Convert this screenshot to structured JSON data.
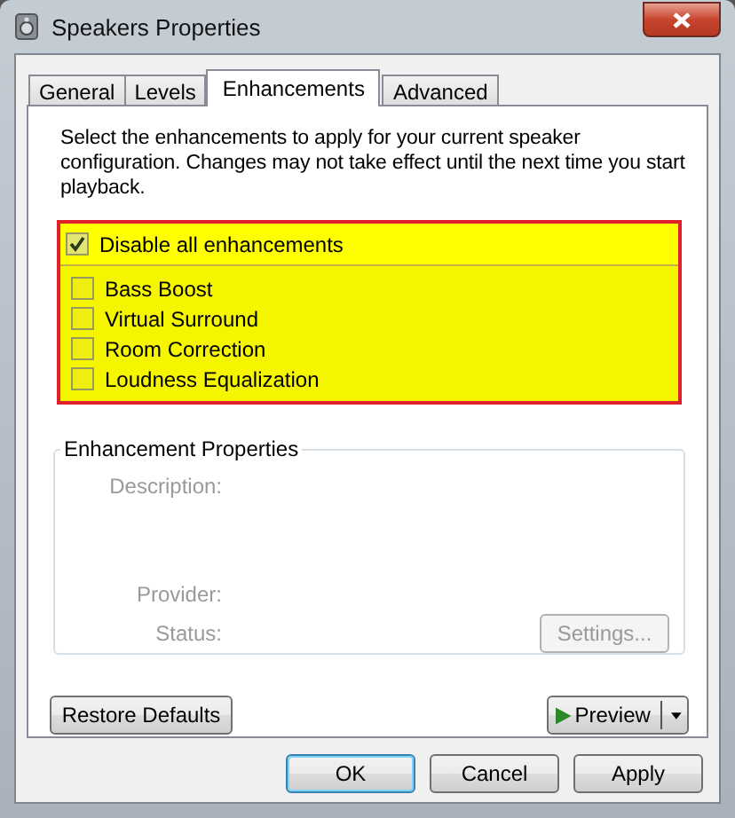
{
  "window": {
    "title": "Speakers Properties"
  },
  "tabs": [
    {
      "label": "General",
      "selected": false
    },
    {
      "label": "Levels",
      "selected": false
    },
    {
      "label": "Enhancements",
      "selected": true
    },
    {
      "label": "Advanced",
      "selected": false
    }
  ],
  "intro": "Select the enhancements to apply for your current speaker configuration. Changes may not take effect until the next time you start playback.",
  "master_option": {
    "label": "Disable all enhancements",
    "checked": true
  },
  "enhancements": [
    {
      "label": "Bass Boost",
      "checked": false
    },
    {
      "label": "Virtual Surround",
      "checked": false
    },
    {
      "label": "Room Correction",
      "checked": false
    },
    {
      "label": "Loudness Equalization",
      "checked": false
    }
  ],
  "properties": {
    "title": "Enhancement Properties",
    "disabled": true,
    "description_label": "Description:",
    "provider_label": "Provider:",
    "status_label": "Status:",
    "settings_button": {
      "label": "Settings...",
      "disabled": true
    }
  },
  "restore_button": "Restore Defaults",
  "preview_button": "Preview",
  "buttons": [
    {
      "label": "OK",
      "selected": true
    },
    {
      "label": "Cancel",
      "selected": false
    },
    {
      "label": "Apply",
      "selected": false
    }
  ]
}
